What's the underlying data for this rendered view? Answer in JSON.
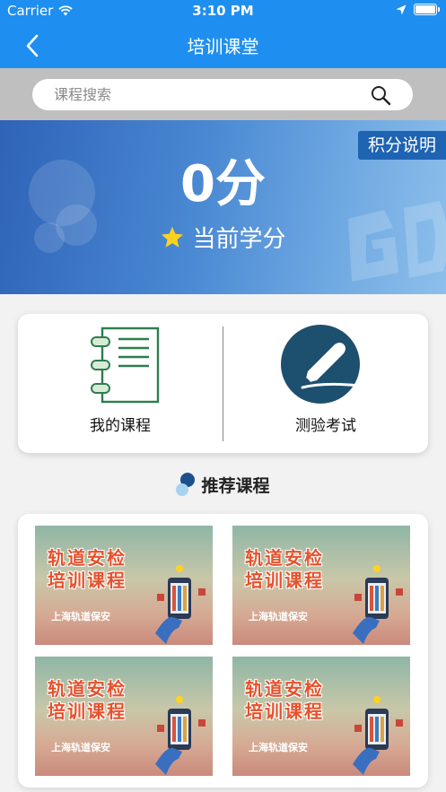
{
  "status_bar": {
    "carrier": "Carrier",
    "time": "3:10 PM"
  },
  "nav": {
    "title": "培训课堂"
  },
  "search": {
    "placeholder": "课程搜索"
  },
  "banner": {
    "score": "0分",
    "credit_label": "当前学分",
    "points_button": "积分说明"
  },
  "menu": {
    "my_courses": "我的课程",
    "exam": "测验考试"
  },
  "recommended": {
    "title": "推荐课程",
    "courses": [
      {
        "line1": "轨道安检",
        "line2": "培训课程",
        "sub": "上海轨道保安"
      },
      {
        "line1": "轨道安检",
        "line2": "培训课程",
        "sub": "上海轨道保安"
      },
      {
        "line1": "轨道安检",
        "line2": "培训课程",
        "sub": "上海轨道保安"
      },
      {
        "line1": "轨道安检",
        "line2": "培训课程",
        "sub": "上海轨道保安"
      }
    ]
  },
  "colors": {
    "primary": "#1e8ff0",
    "banner_start": "#2f63b7",
    "banner_end": "#8dbfeb",
    "points_button": "#1f63b3",
    "icon_teal": "#1d4f6f",
    "notebook_green": "#2e7d4f",
    "thumb_title": "#e6512b"
  },
  "icons": [
    "wifi-icon",
    "location-arrow-icon",
    "battery-icon",
    "back-chevron-icon",
    "search-icon",
    "star-icon",
    "notebook-icon",
    "pen-circle-icon",
    "bubble-icon"
  ]
}
